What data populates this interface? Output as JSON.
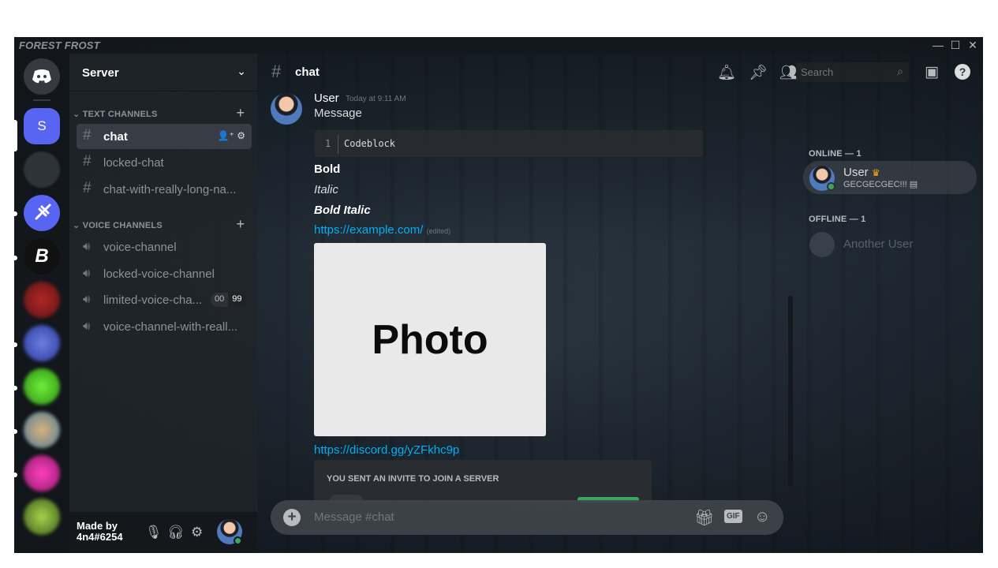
{
  "window": {
    "wordmark": "FOREST FROST",
    "minimize": "—",
    "maximize": "☐",
    "close": "✕"
  },
  "server": {
    "name": "Server",
    "letter": "S"
  },
  "categories": {
    "text": "TEXT CHANNELS",
    "voice": "VOICE CHANNELS"
  },
  "text_channels": [
    {
      "name": "chat",
      "active": true
    },
    {
      "name": "locked-chat",
      "locked": true
    },
    {
      "name": "chat-with-really-long-na..."
    }
  ],
  "voice_channels": [
    {
      "name": "voice-channel"
    },
    {
      "name": "locked-voice-channel",
      "locked": true
    },
    {
      "name": "limited-voice-cha...",
      "user_count": "00",
      "user_limit": "99"
    },
    {
      "name": "voice-channel-with-reall..."
    }
  ],
  "user_panel": {
    "line1": "Made by",
    "line2": "4n4#6254"
  },
  "header": {
    "channel": "chat",
    "search_placeholder": "Search"
  },
  "message": {
    "author": "User",
    "timestamp": "Today at 9:11 AM",
    "text": "Message",
    "code_line_number": "1",
    "code_text": "Codeblock",
    "bold": "Bold",
    "italic": "Italic",
    "bold_italic": "Bold Italic",
    "link": "https://example.com/",
    "edited": "(edited)",
    "photo_label": "Photo",
    "invite_link": "https://discord.gg/yZFkhc9p",
    "invite_header": "YOU SENT AN INVITE TO JOIN A SERVER"
  },
  "composer": {
    "placeholder": "Message #chat",
    "gif_label": "GIF"
  },
  "members": {
    "online_header": "ONLINE — 1",
    "offline_header": "OFFLINE — 1",
    "online": [
      {
        "name": "User",
        "status": "GECGECGEC!!!",
        "owner": true
      }
    ],
    "offline": [
      {
        "name": "Another User"
      }
    ]
  },
  "colors": {
    "accent": "#5865f2",
    "online": "#3ba55d",
    "link": "#00aff4"
  }
}
